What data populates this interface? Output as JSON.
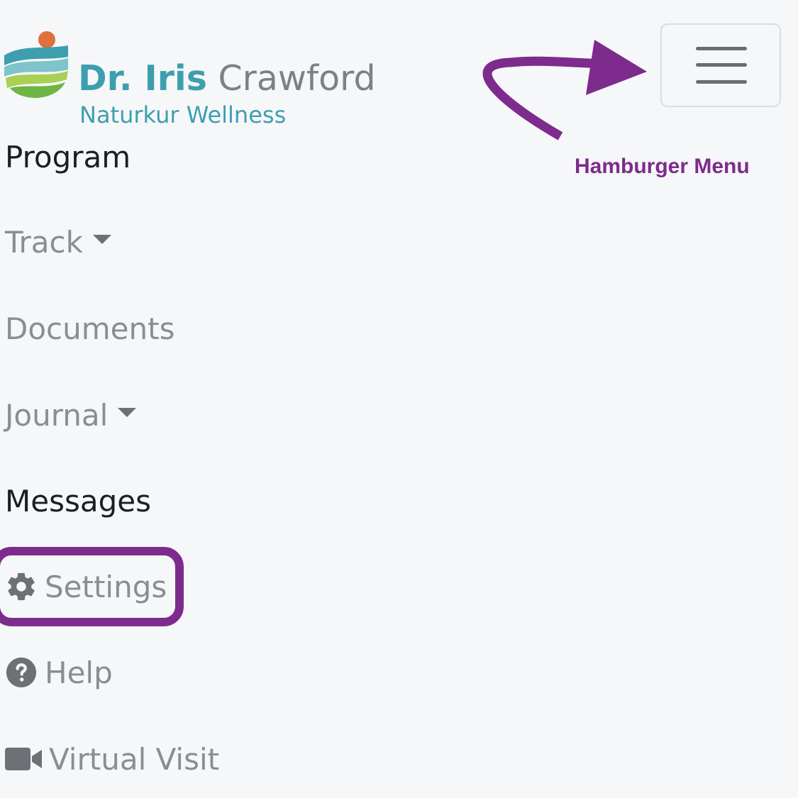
{
  "brand": {
    "name_bold": "Dr. Iris",
    "name_light": "Crawford",
    "subtitle": "Naturkur Wellness"
  },
  "toggler": {
    "icon": "hamburger-icon"
  },
  "annotation": {
    "label": "Hamburger Menu",
    "color": "#7d2b8c"
  },
  "nav": {
    "items": [
      {
        "label": "Program",
        "active": true
      },
      {
        "label": "Track",
        "dropdown": true
      },
      {
        "label": "Documents"
      },
      {
        "label": "Journal",
        "dropdown": true
      },
      {
        "label": "Messages",
        "active": true
      },
      {
        "label": "Settings",
        "icon": "gear-icon",
        "highlighted": true
      },
      {
        "label": "Help",
        "icon": "question-circle-icon"
      },
      {
        "label": "Virtual Visit",
        "icon": "video-camera-icon"
      }
    ]
  },
  "colors": {
    "brand_teal": "#3d9fae",
    "brand_gray": "#7b8187",
    "nav_active": "#1c1e21",
    "nav_inactive": "#8a8d91",
    "background": "#f6f7f9"
  }
}
